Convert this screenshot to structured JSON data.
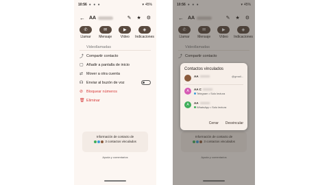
{
  "status": {
    "time": "10:56",
    "right": "45%"
  },
  "contact": {
    "name": "AA"
  },
  "actions": [
    {
      "label": "Llamar",
      "icon": "phone-icon",
      "glyph": "✆"
    },
    {
      "label": "Mensaje",
      "icon": "message-icon",
      "glyph": "✉"
    },
    {
      "label": "Vídeo",
      "icon": "video-icon",
      "glyph": "▶"
    },
    {
      "label": "Indicaciones",
      "icon": "directions-icon",
      "glyph": "◈"
    }
  ],
  "menu": {
    "cut_label": "Videollamadas",
    "items": [
      {
        "label": "Compartir contacto",
        "icon": "share-icon",
        "glyph": "⤴"
      },
      {
        "label": "Añadir a pantalla de inicio",
        "icon": "home-screen-icon",
        "glyph": "▢"
      },
      {
        "label": "Mover a otra cuenta",
        "icon": "move-account-icon",
        "glyph": "⇄"
      },
      {
        "label": "Enviar al buzón de voz",
        "icon": "voicemail-icon",
        "glyph": "☊"
      },
      {
        "label": "Bloquear números",
        "icon": "block-icon",
        "glyph": "⊘"
      },
      {
        "label": "Eliminar",
        "icon": "trash-icon",
        "glyph": "🗑"
      }
    ]
  },
  "info": {
    "line1": "Información de contacto de",
    "line2": "3 contactos vinculados"
  },
  "help": "Ayuda y comentarios",
  "dialog": {
    "title": "Contactos vinculados",
    "accounts": [
      {
        "initial": "",
        "name": "AA",
        "sub": "",
        "email": "@gmail...",
        "color": "#8a5a3c"
      },
      {
        "initial": "A",
        "name": "AA C",
        "sub": "Telegram • Solo lectura",
        "email": "",
        "color": "#d65ab4"
      },
      {
        "initial": "A",
        "name": "AA",
        "sub": "WhatsApp • Solo lectura",
        "email": "",
        "color": "#3fae5a"
      }
    ],
    "close_label": "Cerrar",
    "unlink_label": "Desvincular"
  },
  "colors": {
    "accent_pill": "#5a4a3f",
    "danger": "#d63a3a"
  }
}
